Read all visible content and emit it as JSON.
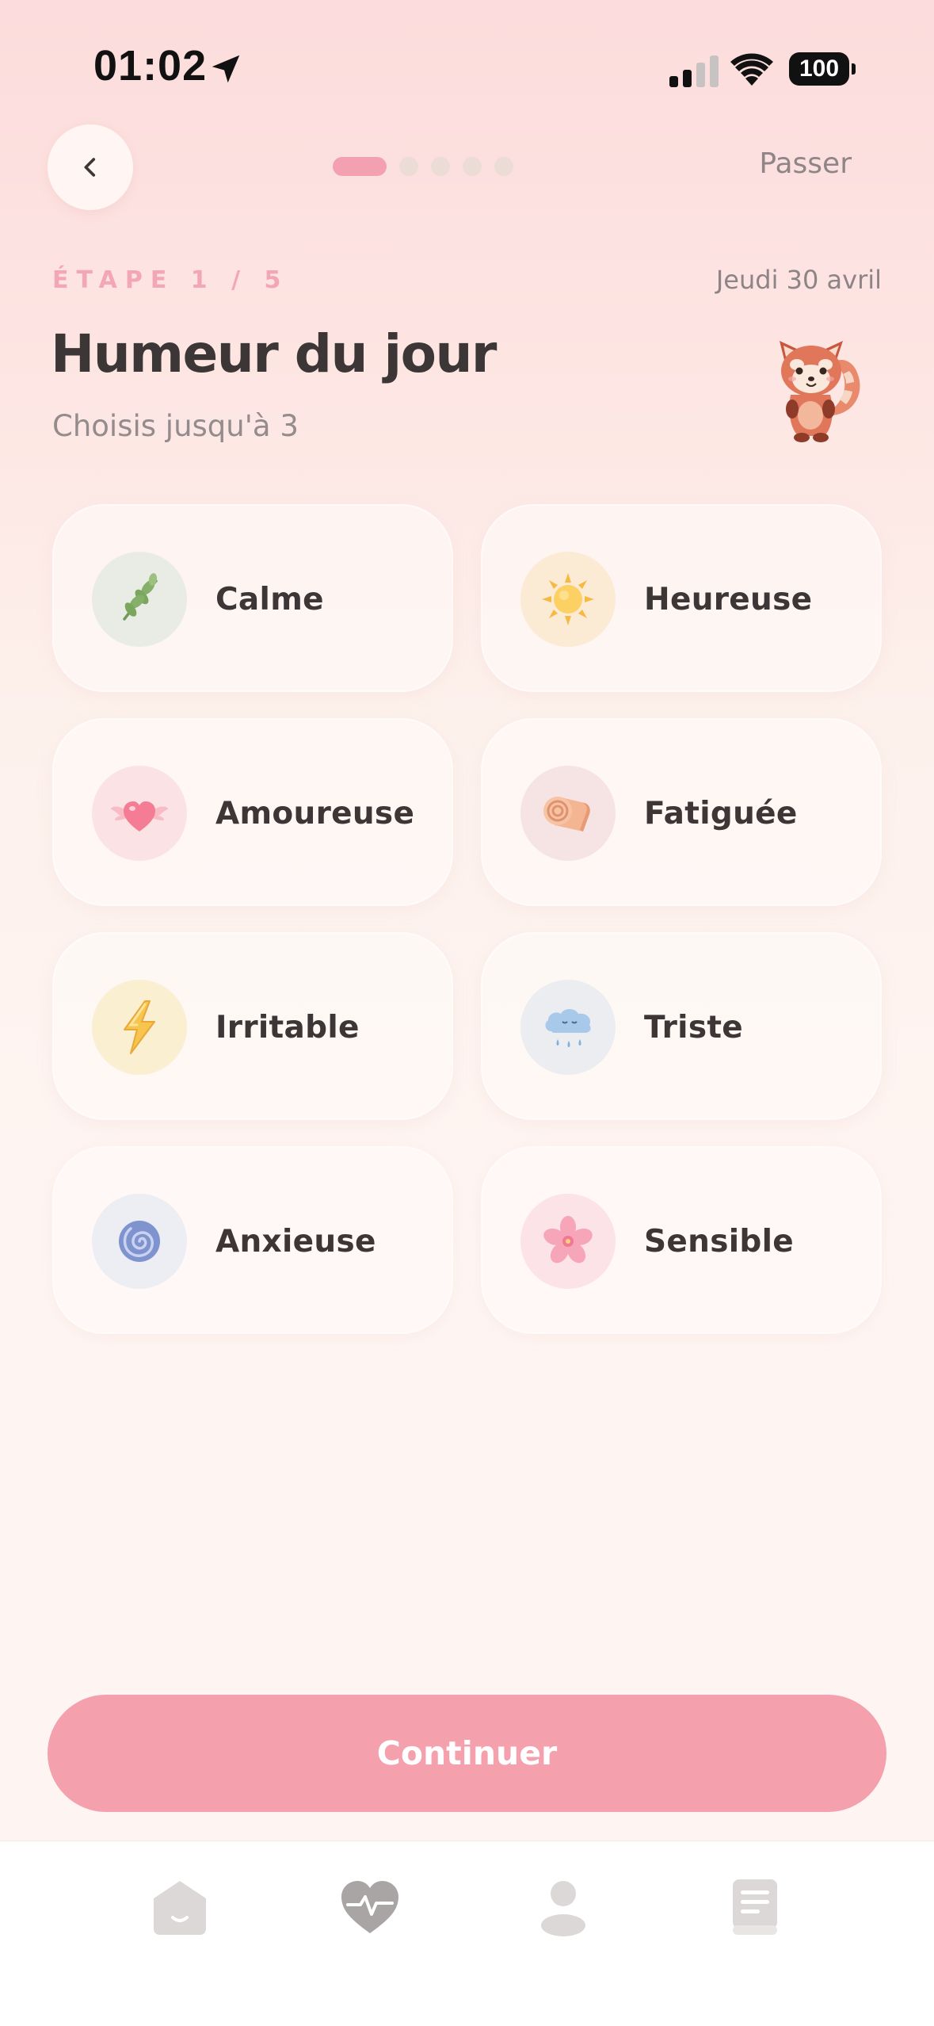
{
  "status_bar": {
    "time": "01:02",
    "battery": "100"
  },
  "nav": {
    "skip_label": "Passer",
    "steps_total": 5,
    "current_step": 1
  },
  "header": {
    "step_label": "ÉTAPE 1 / 5",
    "date": "Jeudi 30 avril",
    "title": "Humeur du jour",
    "subtitle": "Choisis jusqu'à 3"
  },
  "moods": [
    {
      "label": "Calme",
      "icon": "leaf-icon",
      "bg": "#e9ece4"
    },
    {
      "label": "Heureuse",
      "icon": "sun-icon",
      "bg": "#fbead4"
    },
    {
      "label": "Amoureuse",
      "icon": "winged-heart-icon",
      "bg": "#fbe2e4"
    },
    {
      "label": "Fatiguée",
      "icon": "blanket-roll-icon",
      "bg": "#f6e4e4"
    },
    {
      "label": "Irritable",
      "icon": "lightning-icon",
      "bg": "#fbefd2"
    },
    {
      "label": "Triste",
      "icon": "rain-cloud-icon",
      "bg": "#ebedf1"
    },
    {
      "label": "Anxieuse",
      "icon": "spiral-icon",
      "bg": "#eceef3"
    },
    {
      "label": "Sensible",
      "icon": "cherry-blossom-icon",
      "bg": "#fbe3e7"
    }
  ],
  "continue_label": "Continuer",
  "tabs": [
    {
      "name": "home",
      "icon": "home-icon"
    },
    {
      "name": "health",
      "icon": "heart-pulse-icon"
    },
    {
      "name": "profile",
      "icon": "person-icon"
    },
    {
      "name": "journal",
      "icon": "book-icon"
    }
  ],
  "colors": {
    "accent": "#f4a0ad",
    "step_label": "#f3a6b4",
    "tab_icon": "#c9c5c5"
  }
}
